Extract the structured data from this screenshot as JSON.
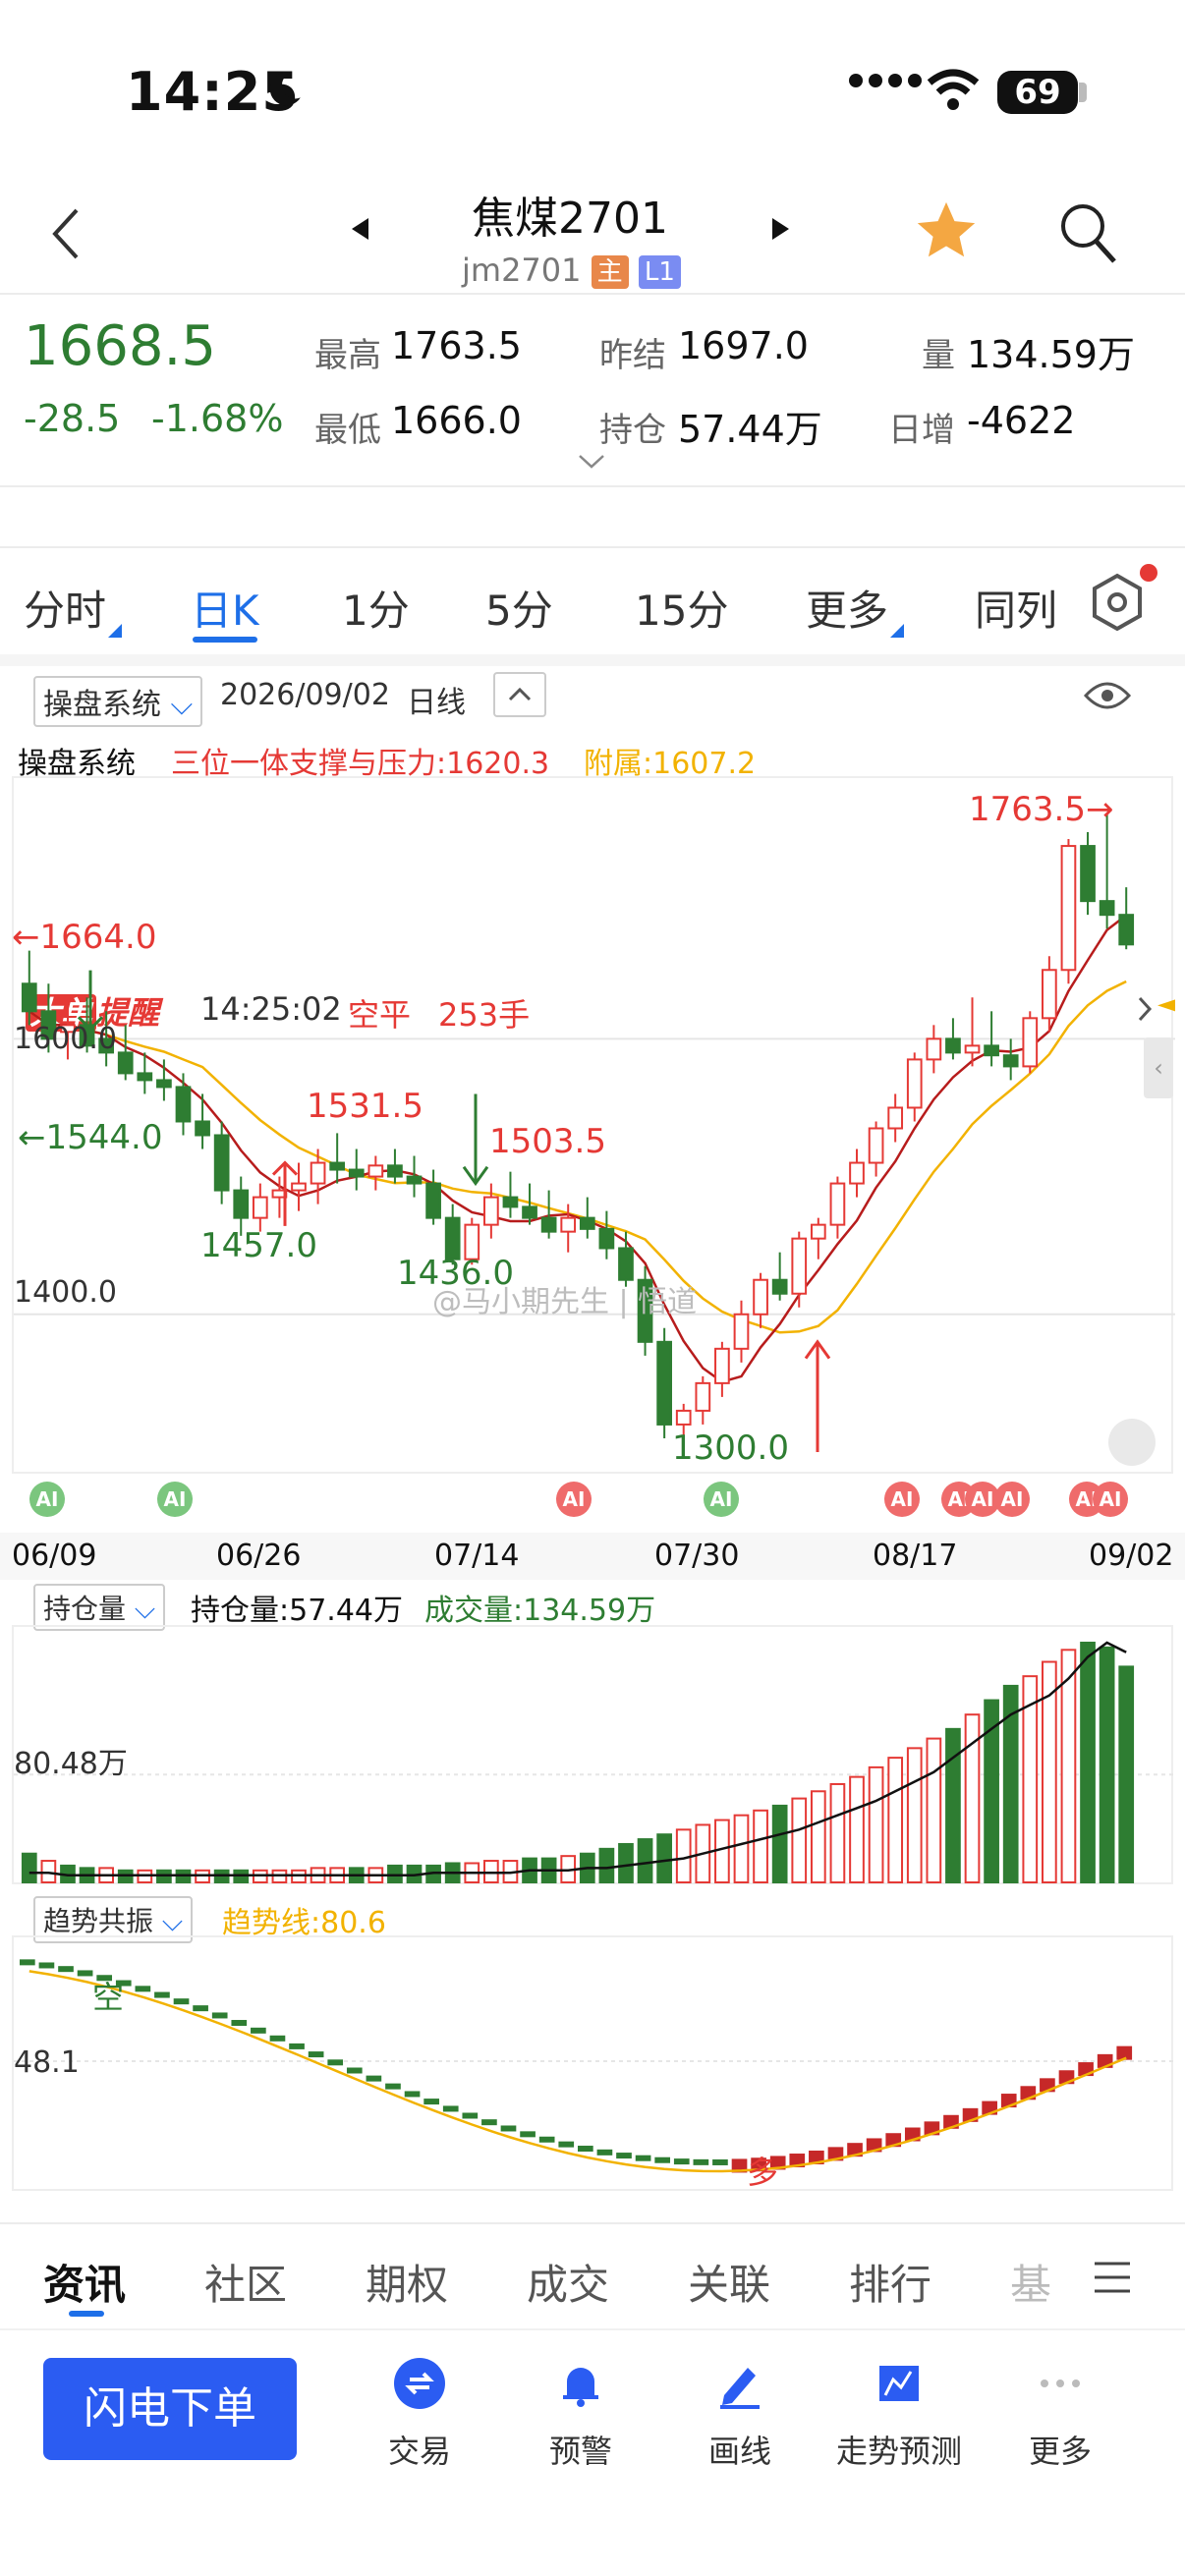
{
  "status_bar": {
    "time": "14:25",
    "battery": "69"
  },
  "header": {
    "title": "焦煤2701",
    "code": "jm2701",
    "badge_main": "主",
    "badge_l1": "L1"
  },
  "quote": {
    "last": "1668.5",
    "change": "-28.5",
    "change_pct": "-1.68%",
    "high_label": "最高",
    "high": "1763.5",
    "low_label": "最低",
    "low": "1666.0",
    "prev_settle_label": "昨结",
    "prev_settle": "1697.0",
    "oi_label": "持仓",
    "oi": "57.44万",
    "vol_label": "量",
    "vol": "134.59万",
    "daily_inc_label": "日增",
    "daily_inc": "-4622"
  },
  "alert": {
    "badge1": "大单",
    "badge2": "提醒",
    "time": "14:25:02",
    "action": "空平",
    "qty": "253手"
  },
  "tabs": [
    "分时",
    "日K",
    "1分",
    "5分",
    "15分",
    "更多",
    "同列"
  ],
  "active_tab": "日K",
  "chart_toolbar": {
    "system": "操盘系统",
    "date": "2026/09/02",
    "period": "日线"
  },
  "indicator_line": {
    "name": "操盘系统",
    "support_label": "三位一体支撑与压力:1620.3",
    "aux_label": "附属:1607.2"
  },
  "chart_labels": {
    "max": "1763.5→",
    "l1664": "←1664.0",
    "l1600": "1600.0",
    "l1544": "←1544.0",
    "l1531": "1531.5",
    "l1503": "1503.5",
    "l1457": "1457.0",
    "l1436": "1436.0",
    "l1400": "1400.0",
    "l1300": "1300.0",
    "watermark": "@马小期先生 | 悟道"
  },
  "ai_badge": "AI",
  "dates": [
    "06/09",
    "06/26",
    "07/14",
    "07/30",
    "08/17",
    "09/02"
  ],
  "oi_panel": {
    "selector": "持仓量",
    "oi_label": "持仓量:57.44万",
    "vol_label": "成交量:134.59万",
    "axis": "80.48万"
  },
  "trend_panel": {
    "selector": "趋势共振",
    "trend_label": "趋势线:80.6",
    "axis": "48.1",
    "kong": "空",
    "duo": "多"
  },
  "bottom_tabs": [
    "资讯",
    "社区",
    "期权",
    "成交",
    "关联",
    "排行",
    "基"
  ],
  "footer": {
    "order": "闪电下单",
    "items": [
      "交易",
      "预警",
      "画线",
      "走势预测",
      "更多"
    ]
  },
  "colors": {
    "up": "#e53935",
    "down": "#2e7d32",
    "accent": "#1e6fe8",
    "ma_yellow": "#f2b200",
    "ma_red": "#b71c1c"
  },
  "chart_data": {
    "type": "candlestick",
    "ylim": [
      1290,
      1775
    ],
    "highest": 1763.5,
    "lowest": 1300.0,
    "ohlc": [
      [
        1640,
        1664,
        1610,
        1620
      ],
      [
        1620,
        1640,
        1590,
        1600
      ],
      [
        1605,
        1625,
        1585,
        1610
      ],
      [
        1610,
        1630,
        1590,
        1595
      ],
      [
        1600,
        1620,
        1580,
        1590
      ],
      [
        1590,
        1610,
        1570,
        1575
      ],
      [
        1575,
        1590,
        1560,
        1570
      ],
      [
        1570,
        1585,
        1555,
        1565
      ],
      [
        1565,
        1575,
        1530,
        1540
      ],
      [
        1540,
        1560,
        1520,
        1530
      ],
      [
        1530,
        1540,
        1480,
        1490
      ],
      [
        1490,
        1500,
        1457,
        1470
      ],
      [
        1470,
        1495,
        1460,
        1485
      ],
      [
        1485,
        1500,
        1470,
        1490
      ],
      [
        1490,
        1510,
        1475,
        1495
      ],
      [
        1495,
        1520,
        1480,
        1510
      ],
      [
        1510,
        1531.5,
        1495,
        1505
      ],
      [
        1505,
        1520,
        1490,
        1500
      ],
      [
        1500,
        1515,
        1490,
        1508
      ],
      [
        1508,
        1520,
        1495,
        1500
      ],
      [
        1500,
        1515,
        1485,
        1495
      ],
      [
        1495,
        1505,
        1465,
        1470
      ],
      [
        1470,
        1480,
        1436,
        1440
      ],
      [
        1440,
        1470,
        1436,
        1465
      ],
      [
        1465,
        1495,
        1455,
        1485
      ],
      [
        1485,
        1503.5,
        1470,
        1478
      ],
      [
        1478,
        1495,
        1465,
        1470
      ],
      [
        1470,
        1490,
        1455,
        1460
      ],
      [
        1460,
        1480,
        1445,
        1470
      ],
      [
        1470,
        1485,
        1455,
        1462
      ],
      [
        1462,
        1475,
        1440,
        1448
      ],
      [
        1448,
        1460,
        1420,
        1425
      ],
      [
        1425,
        1435,
        1370,
        1380
      ],
      [
        1380,
        1390,
        1310,
        1320
      ],
      [
        1320,
        1335,
        1300,
        1330
      ],
      [
        1330,
        1355,
        1320,
        1350
      ],
      [
        1350,
        1380,
        1340,
        1375
      ],
      [
        1375,
        1410,
        1365,
        1400
      ],
      [
        1400,
        1430,
        1390,
        1425
      ],
      [
        1425,
        1445,
        1410,
        1415
      ],
      [
        1415,
        1460,
        1405,
        1455
      ],
      [
        1455,
        1470,
        1440,
        1465
      ],
      [
        1465,
        1500,
        1455,
        1495
      ],
      [
        1495,
        1520,
        1485,
        1510
      ],
      [
        1510,
        1540,
        1500,
        1535
      ],
      [
        1535,
        1560,
        1525,
        1550
      ],
      [
        1550,
        1590,
        1540,
        1585
      ],
      [
        1585,
        1610,
        1575,
        1600
      ],
      [
        1600,
        1615,
        1585,
        1590
      ],
      [
        1590,
        1630,
        1580,
        1595
      ],
      [
        1595,
        1620,
        1580,
        1588
      ],
      [
        1588,
        1600,
        1570,
        1580
      ],
      [
        1580,
        1620,
        1575,
        1615
      ],
      [
        1615,
        1660,
        1605,
        1650
      ],
      [
        1650,
        1745,
        1640,
        1740
      ],
      [
        1740,
        1750,
        1690,
        1700
      ],
      [
        1700,
        1763.5,
        1680,
        1690
      ],
      [
        1690,
        1710,
        1665,
        1668.5
      ]
    ],
    "oi_bars": [
      12,
      9,
      7,
      6,
      6,
      5,
      5,
      5,
      5,
      5,
      5,
      5,
      5,
      5,
      5,
      6,
      6,
      6,
      6,
      7,
      7,
      7,
      8,
      8,
      9,
      9,
      10,
      10,
      11,
      12,
      14,
      16,
      18,
      20,
      22,
      24,
      26,
      28,
      30,
      32,
      35,
      38,
      41,
      44,
      48,
      52,
      56,
      60,
      64,
      70,
      76,
      82,
      86,
      92,
      97,
      100,
      98,
      90
    ],
    "oi_bar_up": [
      false,
      true,
      false,
      false,
      true,
      false,
      true,
      false,
      false,
      true,
      false,
      false,
      true,
      true,
      true,
      true,
      true,
      false,
      true,
      false,
      false,
      false,
      false,
      true,
      true,
      true,
      false,
      false,
      true,
      false,
      false,
      false,
      false,
      false,
      true,
      true,
      true,
      true,
      true,
      false,
      true,
      true,
      true,
      true,
      true,
      true,
      true,
      true,
      false,
      true,
      false,
      false,
      true,
      true,
      true,
      false,
      false,
      false
    ],
    "oi_line": [
      4,
      4,
      3,
      3,
      3,
      3,
      3,
      3,
      3,
      3,
      3,
      3,
      3,
      3,
      3,
      3,
      3,
      3,
      3,
      3,
      3,
      4,
      4,
      4,
      4,
      4,
      5,
      5,
      5,
      6,
      6,
      7,
      8,
      9,
      10,
      12,
      14,
      16,
      18,
      20,
      22,
      25,
      28,
      31,
      34,
      38,
      42,
      46,
      52,
      58,
      64,
      70,
      74,
      78,
      85,
      94,
      100,
      96
    ]
  }
}
